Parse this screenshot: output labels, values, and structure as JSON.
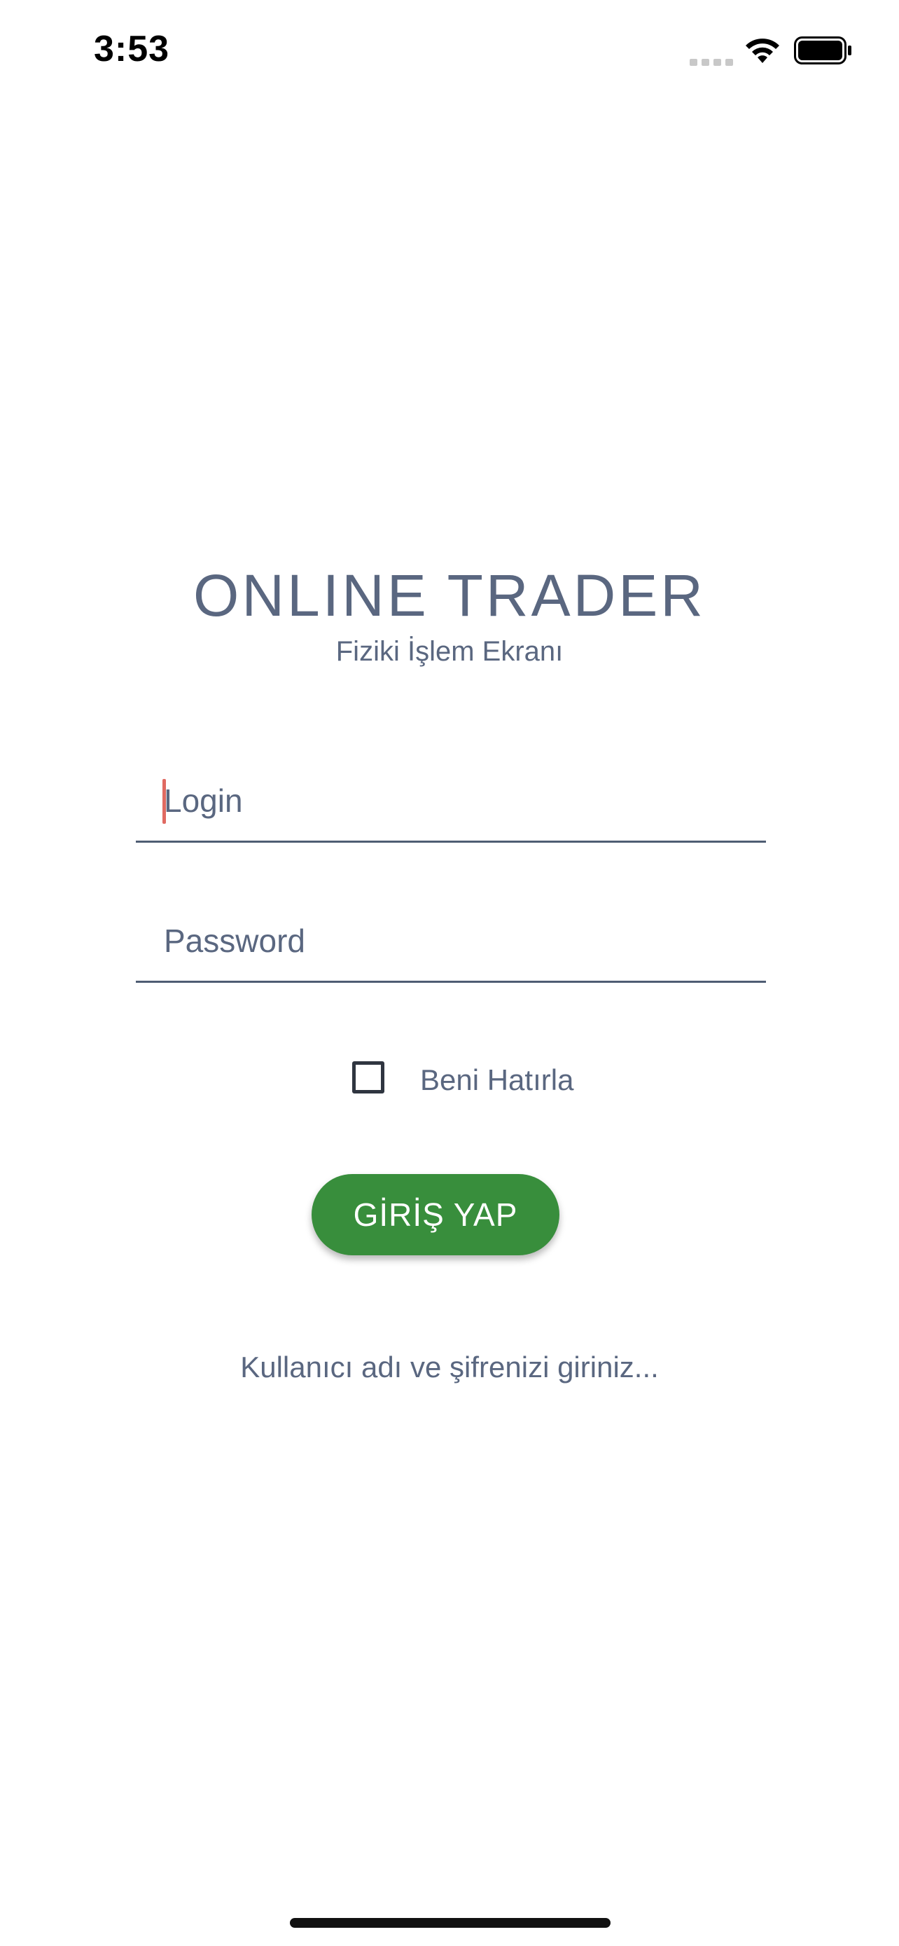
{
  "status_bar": {
    "time": "3:53",
    "icons": [
      "cellular-signal-icon",
      "wifi-icon",
      "battery-icon"
    ]
  },
  "header": {
    "title": "ONLINE TRADER",
    "subtitle": "Fiziki İşlem Ekranı"
  },
  "form": {
    "login": {
      "value": "",
      "placeholder": "Login"
    },
    "password": {
      "value": "",
      "placeholder": "Password"
    },
    "remember_me": {
      "label": "Beni Hatırla",
      "checked": false
    },
    "submit_label": "GİRİŞ YAP"
  },
  "hint": "Kullanıcı adı ve şifrenizi giriniz...",
  "colors": {
    "text": "#5a6780",
    "button": "#388e3c",
    "caret": "#e06a62",
    "underline": "#4f5d73"
  }
}
